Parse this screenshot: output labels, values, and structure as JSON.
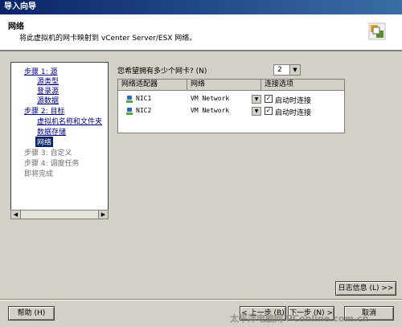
{
  "window": {
    "title": "导入向导"
  },
  "header": {
    "title": "网络",
    "description": "将此虚拟机的网卡映射到 vCenter Server/ESX 网络。"
  },
  "nav": {
    "items": [
      {
        "label": "步骤 1: 源",
        "style": "link"
      },
      {
        "label": "源类型",
        "style": "link"
      },
      {
        "label": "登录源",
        "style": "link"
      },
      {
        "label": "源数据",
        "style": "link"
      },
      {
        "label": "步骤 2: 目标",
        "style": "link"
      },
      {
        "label": "虚拟机名称和文件夹",
        "style": "link"
      },
      {
        "label": "数据存储",
        "style": "link"
      },
      {
        "label": "网络",
        "style": "current"
      },
      {
        "label": "步骤 3: 自定义",
        "style": "gray"
      },
      {
        "label": "步骤 4: 调度任务",
        "style": "gray"
      },
      {
        "label": "即将完成",
        "style": "gray"
      }
    ]
  },
  "question": {
    "label": "您希望拥有多少个网卡? (N)",
    "count": "2"
  },
  "table": {
    "headers": [
      "网络适配器",
      "网络",
      "连接选项"
    ],
    "rows": [
      {
        "adapter": "NIC1",
        "network": "VM Network",
        "option": "启动时连接",
        "checked": true
      },
      {
        "adapter": "NIC2",
        "network": "VM Network",
        "option": "启动时连接",
        "checked": true
      }
    ]
  },
  "buttons": {
    "log": "日志信息 (L) >>",
    "help": "帮助 (H)",
    "back": "< 上一步 (B)",
    "next": "下一步 (N) >",
    "cancel": "取消"
  },
  "watermark": "太平洋电脑网 PConline.com.cn"
}
